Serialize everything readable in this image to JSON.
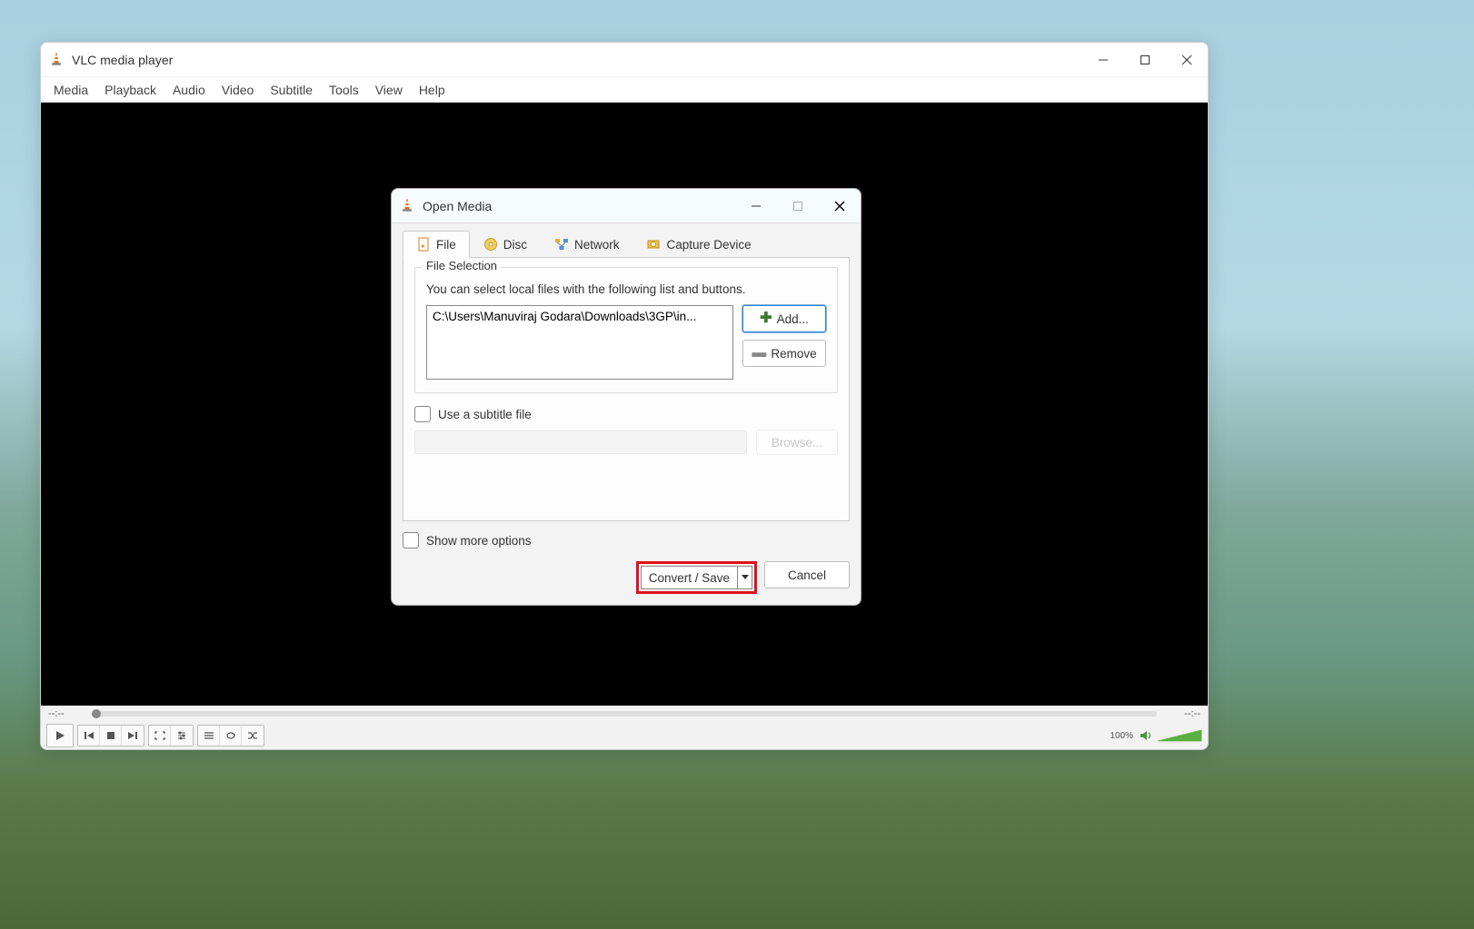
{
  "main_window": {
    "title": "VLC media player",
    "menus": [
      "Media",
      "Playback",
      "Audio",
      "Video",
      "Subtitle",
      "Tools",
      "View",
      "Help"
    ],
    "time_left": "--:--",
    "time_right": "--:--",
    "volume_pct": "100%"
  },
  "dialog": {
    "title": "Open Media",
    "tabs": {
      "file": "File",
      "disc": "Disc",
      "network": "Network",
      "capture": "Capture Device"
    },
    "file_section": {
      "legend": "File Selection",
      "hint": "You can select local files with the following list and buttons.",
      "files": [
        "C:\\Users\\Manuviraj Godara\\Downloads\\3GP\\in..."
      ],
      "add_btn": "Add...",
      "remove_btn": "Remove"
    },
    "subtitle": {
      "checkbox_label": "Use a subtitle file",
      "browse_btn": "Browse..."
    },
    "show_more": "Show more options",
    "convert_btn": "Convert / Save",
    "cancel_btn": "Cancel"
  }
}
